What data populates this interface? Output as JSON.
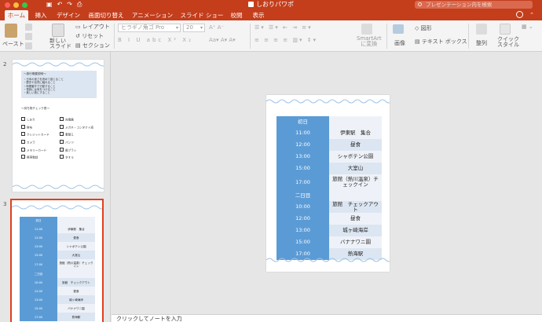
{
  "app": {
    "title": "しおりパワポ",
    "search_placeholder": "プレゼンテーション内を検索"
  },
  "tabs": [
    {
      "label": "ホーム",
      "active": true
    },
    {
      "label": "挿入"
    },
    {
      "label": "デザイン"
    },
    {
      "label": "画面切り替え"
    },
    {
      "label": "アニメーション"
    },
    {
      "label": "スライド ショー"
    },
    {
      "label": "校閲"
    },
    {
      "label": "表示"
    }
  ],
  "ribbon": {
    "paste": "ペースト",
    "new_slide": "新しい\nスライド",
    "layout": "レイアウト",
    "reset": "リセット",
    "section": "セクション",
    "font_name": "ヒラギノ角ゴ Pro",
    "font_size": "20",
    "smartart": "SmartArt\nに変換",
    "picture": "画像",
    "shapes": "図形",
    "textbox": "テキスト ボックス",
    "arrange": "整列",
    "quick_styles": "クイック\nスタイル"
  },
  "thumbnails": {
    "slide2_number": "2",
    "slide3_number": "3",
    "slide2": {
      "notes_title": "〜旅行概要説明〜",
      "notes": [
        "・日本の良さを改めて感じること",
        "・歴史や自然に触れること",
        "・時間厳守で行動すること",
        "・怪我には気をつけること",
        "・楽しい旅にすること"
      ],
      "check_title": "〜持ち物チェック表〜",
      "col1": [
        "しおり",
        "財布",
        "クレジットカード",
        "カメラ",
        "メモリーカード",
        "携帯電話"
      ],
      "col2": [
        "充電器",
        "メガネ・コンタクト液",
        "着替え",
        "パンツ",
        "歯ブラシ",
        "タオル"
      ]
    }
  },
  "schedule": {
    "rows": [
      {
        "time": "初日",
        "event": "",
        "header": true
      },
      {
        "time": "11:00",
        "event": "伊東駅　集合"
      },
      {
        "time": "12:00",
        "event": "昼食"
      },
      {
        "time": "13:00",
        "event": "シャボテン公園"
      },
      {
        "time": "15:00",
        "event": "大室山"
      },
      {
        "time": "17:00",
        "event": "旅館（熱川温泉）チェックイン"
      },
      {
        "time": "二日目",
        "event": "",
        "header": true
      },
      {
        "time": "10:00",
        "event": "旅館　チェックアウト"
      },
      {
        "time": "12:00",
        "event": "昼食"
      },
      {
        "time": "13:00",
        "event": "城ヶ崎海岸"
      },
      {
        "time": "15:00",
        "event": "バナナワニ園"
      },
      {
        "time": "17:00",
        "event": "熱海駅"
      }
    ]
  },
  "notes_placeholder": "クリックしてノートを入力"
}
